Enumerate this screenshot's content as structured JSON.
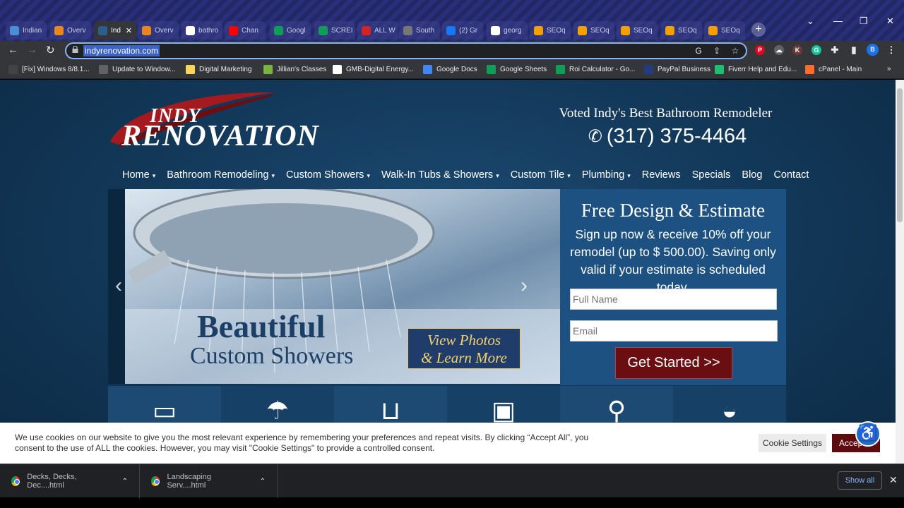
{
  "browser": {
    "tabs": [
      {
        "label": "Indian",
        "favicon": "check-icon",
        "color": "#4a8fd6"
      },
      {
        "label": "Overv",
        "favicon": "a-icon",
        "color": "#e8871e"
      },
      {
        "label": "Ind",
        "favicon": "indy-icon",
        "color": "#2b5d8f",
        "active": true
      },
      {
        "label": "Overv",
        "favicon": "a-icon",
        "color": "#e8871e"
      },
      {
        "label": "bathro",
        "favicon": "google-icon",
        "color": "#ffffff"
      },
      {
        "label": "Chan",
        "favicon": "youtube-icon",
        "color": "#ff0000"
      },
      {
        "label": "Googl",
        "favicon": "sheets-icon",
        "color": "#0f9d58"
      },
      {
        "label": "SCREI",
        "favicon": "sheets-icon",
        "color": "#0f9d58"
      },
      {
        "label": "ALL W",
        "favicon": "yelp-icon",
        "color": "#d32323"
      },
      {
        "label": "South",
        "favicon": "globe-icon",
        "color": "#777777"
      },
      {
        "label": "(2) Gr",
        "favicon": "facebook-icon",
        "color": "#1877f2"
      },
      {
        "label": "georg",
        "favicon": "google-icon",
        "color": "#ffffff"
      },
      {
        "label": "SEOq",
        "favicon": "sq-icon",
        "color": "#f4a100"
      },
      {
        "label": "SEOq",
        "favicon": "sq-icon",
        "color": "#f4a100"
      },
      {
        "label": "SEOq",
        "favicon": "sq-icon",
        "color": "#f4a100"
      },
      {
        "label": "SEOq",
        "favicon": "sq-icon",
        "color": "#f4a100"
      },
      {
        "label": "SEOq",
        "favicon": "sq-icon",
        "color": "#f4a100"
      }
    ],
    "url": "indyrenovation.com",
    "bookmarks": [
      {
        "label": "[Fix] Windows 8/8.1...",
        "icon": "x-icon",
        "color": "#444444"
      },
      {
        "label": "Update to Window...",
        "icon": "globe-icon",
        "color": "#5f6368"
      },
      {
        "label": "Digital Marketing",
        "icon": "folder-icon",
        "color": "#f9d55b"
      },
      {
        "label": "Jillian's Classes",
        "icon": "classes-icon",
        "color": "#7bb342"
      },
      {
        "label": "GMB-Digital Energy...",
        "icon": "google-icon",
        "color": "#ffffff"
      },
      {
        "label": "Google Docs",
        "icon": "docs-icon",
        "color": "#4285f4"
      },
      {
        "label": "Google Sheets",
        "icon": "sheets-icon",
        "color": "#0f9d58"
      },
      {
        "label": "Roi Calculator - Go...",
        "icon": "sheets-icon",
        "color": "#0f9d58"
      },
      {
        "label": "PayPal Business",
        "icon": "paypal-icon",
        "color": "#253b80"
      },
      {
        "label": "Fiverr Help and Edu...",
        "icon": "fiverr-icon",
        "color": "#1dbf73"
      },
      {
        "label": "cPanel - Main",
        "icon": "cpanel-icon",
        "color": "#ff6c2c"
      }
    ]
  },
  "site": {
    "logo_line1": "INDY",
    "logo_line2": "RENOVATION",
    "tagline": "Voted Indy's Best Bathroom Remodeler",
    "phone": "(317) 375-4464",
    "nav": [
      {
        "label": "Home",
        "dropdown": true
      },
      {
        "label": "Bathroom Remodeling",
        "dropdown": true
      },
      {
        "label": "Custom Showers",
        "dropdown": true
      },
      {
        "label": "Walk-In Tubs & Showers",
        "dropdown": true
      },
      {
        "label": "Custom Tile",
        "dropdown": true
      },
      {
        "label": "Plumbing",
        "dropdown": true
      },
      {
        "label": "Reviews",
        "dropdown": false
      },
      {
        "label": "Specials",
        "dropdown": false
      },
      {
        "label": "Blog",
        "dropdown": false
      },
      {
        "label": "Contact",
        "dropdown": false
      }
    ],
    "slide": {
      "heading": "Beautiful",
      "subheading": "Custom Showers",
      "cta_line1": "View Photos",
      "cta_line2": "& Learn More"
    },
    "estimate": {
      "title": "Free Design & Estimate",
      "text": "Sign up now & receive 10% off your remodel (up to $ 500.00). Saving only valid if your estimate is scheduled today.",
      "name_placeholder": "Full Name",
      "email_placeholder": "Email",
      "button": "Get Started >>"
    },
    "services": [
      {
        "icon": "toilet-icon",
        "bg": "#1d4a72"
      },
      {
        "icon": "showerhead-icon",
        "bg": "#174066"
      },
      {
        "icon": "bathtub-icon",
        "bg": "#1d4a72"
      },
      {
        "icon": "tile-icon",
        "bg": "#174066"
      },
      {
        "icon": "plumbing-icon",
        "bg": "#1d4a72"
      },
      {
        "icon": "sink-icon",
        "bg": "#174066"
      }
    ],
    "cookie": {
      "text": "We use cookies on our website to give you the most relevant experience by remembering your preferences and repeat visits. By clicking “Accept All”, you consent to the use of ALL the cookies. However, you may visit \"Cookie Settings\" to provide a controlled consent.",
      "settings_label": "Cookie Settings",
      "accept_label": "Accept"
    }
  },
  "downloads": {
    "items": [
      {
        "label": "Decks, Decks, Dec....html"
      },
      {
        "label": "Landscaping Serv....html"
      }
    ],
    "show_all": "Show all"
  }
}
